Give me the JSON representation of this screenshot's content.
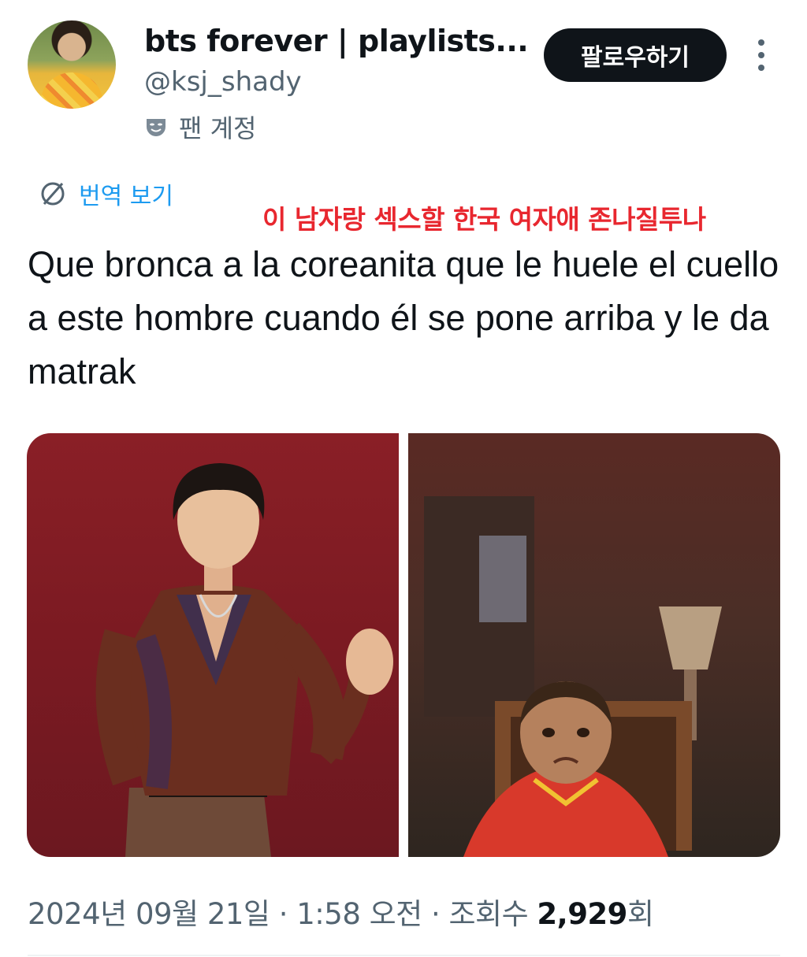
{
  "author": {
    "display_name": "bts forever | playlists...",
    "handle": "@ksj_shady",
    "account_type": "팬 계정",
    "avatar_icon": "user-avatar"
  },
  "actions": {
    "follow_label": "팔로우하기",
    "more_icon": "more-vertical-icon"
  },
  "translate": {
    "label": "번역 보기",
    "icon": "translate-icon"
  },
  "overlay_caption": "이 남자랑 섹스할 한국 여자애 존나질투나",
  "tweet": {
    "text": "Que bronca a la coreanita que le huele el cuello a este hombre cuando él se pone arriba y le da matrak"
  },
  "media": [
    {
      "label": "man-waving-photo"
    },
    {
      "label": "crying-child-photo"
    }
  ],
  "meta": {
    "date": "2024년 09월 21일",
    "separator": "·",
    "time": "1:58 오전",
    "views_label": "조회수",
    "views_count": "2,929",
    "views_suffix": "회"
  },
  "colors": {
    "accent_link": "#1d9bf0",
    "button_bg": "#0f1419",
    "caption_red": "#e8272f",
    "secondary_text": "#536471"
  }
}
